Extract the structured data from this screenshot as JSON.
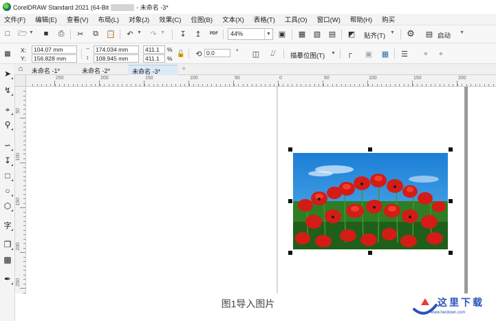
{
  "window": {
    "title_prefix": "CorelDRAW Standard 2021 (64-Bit",
    "title_suffix": "- 未命名 -3*"
  },
  "menu": [
    "文件(F)",
    "编辑(E)",
    "查看(V)",
    "布局(L)",
    "对象(J)",
    "效果(C)",
    "位图(B)",
    "文本(X)",
    "表格(T)",
    "工具(O)",
    "窗口(W)",
    "帮助(H)",
    "购买"
  ],
  "toolbar": {
    "zoom": "44%",
    "snap_label": "贴齐(T)",
    "launch_label": "启动"
  },
  "properties": {
    "x_label": "X:",
    "y_label": "Y:",
    "x": "104.07 mm",
    "y": "156.828 mm",
    "width": "174.034 mm",
    "height": "108.945 mm",
    "scale_w": "411.1",
    "scale_h": "411.1",
    "pct": "%",
    "rotation": "0.0",
    "trace_label": "描摹位图(T)"
  },
  "tabs": [
    {
      "label": "未命名 -1*",
      "active": false
    },
    {
      "label": "未命名 -2*",
      "active": false
    },
    {
      "label": "未命名 -3*",
      "active": true
    }
  ],
  "ruler": {
    "h_labels": [
      "250",
      "200",
      "150",
      "100",
      "50",
      "0",
      "50",
      "100",
      "150",
      "200"
    ],
    "v_labels": [
      "50",
      "100",
      "150",
      "200",
      "250"
    ]
  },
  "caption": "图1导入图片",
  "watermark": {
    "text": "这里下载",
    "url": "www.herdown.com"
  }
}
